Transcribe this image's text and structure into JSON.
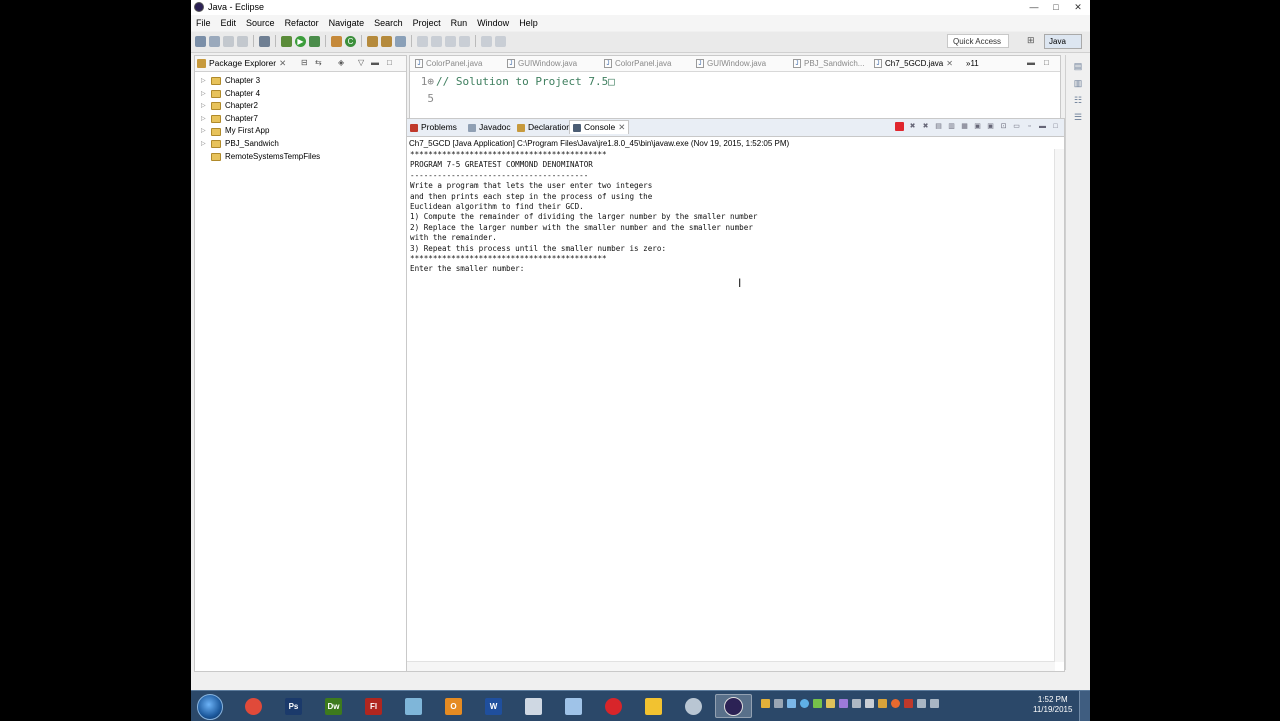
{
  "window": {
    "title": "Java - Eclipse",
    "controls": [
      "—",
      "□",
      "✕"
    ]
  },
  "menubar": [
    "File",
    "Edit",
    "Source",
    "Refactor",
    "Navigate",
    "Search",
    "Project",
    "Run",
    "Window",
    "Help"
  ],
  "toolbar": {
    "quick_access": "Quick Access",
    "perspective": "Java"
  },
  "package_explorer": {
    "title": "Package Explorer",
    "items": [
      {
        "label": "Chapter 3",
        "arrow": "▷"
      },
      {
        "label": "Chapter 4",
        "arrow": "▷"
      },
      {
        "label": "Chapter2",
        "arrow": "▷"
      },
      {
        "label": "Chapter7",
        "arrow": "▷"
      },
      {
        "label": "My First App",
        "arrow": "▷"
      },
      {
        "label": "PBJ_Sandwich",
        "arrow": "▷"
      },
      {
        "label": "RemoteSystemsTempFiles",
        "arrow": ""
      }
    ]
  },
  "editor": {
    "tabs": [
      {
        "label": "ColorPanel.java"
      },
      {
        "label": "GUIWindow.java"
      },
      {
        "label": "ColorPanel.java"
      },
      {
        "label": "GUIWindow.java"
      },
      {
        "label": "PBJ_Sandwich..."
      },
      {
        "label": "Ch7_5GCD.java"
      }
    ],
    "overflow": "»11",
    "lines": [
      {
        "num": "1⊕",
        "text": "// Solution to Project 7.5□"
      },
      {
        "num": "5",
        "text": ""
      }
    ]
  },
  "console": {
    "tabs": [
      "Problems",
      "Javadoc",
      "Declaration",
      "Console"
    ],
    "launch_info": "Ch7_5GCD [Java Application] C:\\Program Files\\Java\\jre1.8.0_45\\bin\\javaw.exe (Nov 19, 2015, 1:52:05 PM)",
    "output": "*******************************************\nPROGRAM 7-5 GREATEST COMMOND DENOMINATOR\n---------------------------------------\nWrite a program that lets the user enter two integers\nand then prints each step in the process of using the\nEuclidean algorithm to find their GCD.\n1) Compute the remainder of dividing the larger number by the smaller number\n2) Replace the larger number with the smaller number and the smaller number\nwith the remainder.\n3) Repeat this process until the smaller number is zero:\n*******************************************\nEnter the smaller number: "
  },
  "taskbar": {
    "apps": [
      {
        "name": "chrome-icon",
        "label": "",
        "color": "#e04a3a"
      },
      {
        "name": "photoshop-icon",
        "label": "Ps",
        "color": "#1b3a6b"
      },
      {
        "name": "dreamweaver-icon",
        "label": "Dw",
        "color": "#3d7a1d"
      },
      {
        "name": "flash-icon",
        "label": "Fl",
        "color": "#b0261f"
      },
      {
        "name": "files-icon",
        "label": "",
        "color": "#7fb6d9"
      },
      {
        "name": "outlook-icon",
        "label": "O",
        "color": "#e58b22"
      },
      {
        "name": "word-icon",
        "label": "W",
        "color": "#1f4f9e"
      },
      {
        "name": "snipping-icon",
        "label": "",
        "color": "#cfd8e3"
      },
      {
        "name": "tool-icon",
        "label": "",
        "color": "#9fc3e8"
      },
      {
        "name": "burst-icon",
        "label": "",
        "color": "#d8252a"
      },
      {
        "name": "grid-app-icon",
        "label": "",
        "color": "#f2c230"
      },
      {
        "name": "settings-app-icon",
        "label": "",
        "color": "#b9c6d3"
      },
      {
        "name": "eclipse-icon",
        "label": "",
        "color": "#2c2255"
      }
    ],
    "clock_time": "1:52 PM",
    "clock_date": "11/19/2015"
  }
}
